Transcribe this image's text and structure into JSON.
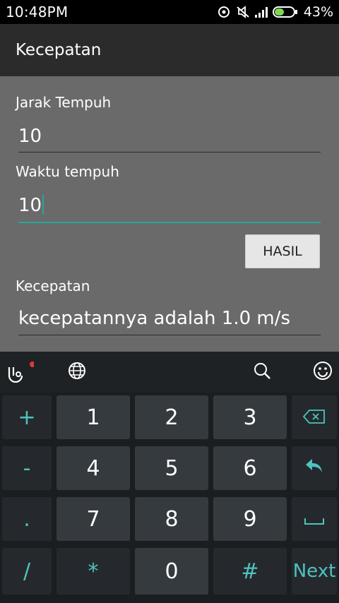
{
  "status": {
    "time": "10:48PM",
    "battery_pct": "43%",
    "icons": [
      "sync-icon",
      "mute-icon",
      "signal-icon",
      "battery-icon"
    ]
  },
  "app": {
    "title": "Kecepatan"
  },
  "form": {
    "distance": {
      "label": "Jarak Tempuh",
      "value": "10"
    },
    "time": {
      "label": "Waktu tempuh",
      "value": "10"
    },
    "button": "HASIL",
    "result": {
      "label": "Kecepatan",
      "value": "kecepatannya adalah 1.0 m/s"
    }
  },
  "keyboard": {
    "toolbar_icons": [
      "touchpal-logo-icon",
      "globe-icon",
      "search-icon",
      "emoji-icon"
    ],
    "rows": [
      {
        "side": "+",
        "keys": [
          "1",
          "2",
          "3"
        ],
        "right": "backspace-icon"
      },
      {
        "side": "-",
        "keys": [
          "4",
          "5",
          "6"
        ],
        "right": "undo-icon"
      },
      {
        "side": ".",
        "keys": [
          "7",
          "8",
          "9"
        ],
        "right": "space-icon"
      },
      {
        "side": "/",
        "keys": [
          "*",
          "0",
          "#"
        ],
        "right": "Next"
      }
    ]
  },
  "colors": {
    "accent": "#26a69a",
    "key_side_text": "#4ec3bf",
    "form_bg": "#6a6a6a"
  }
}
